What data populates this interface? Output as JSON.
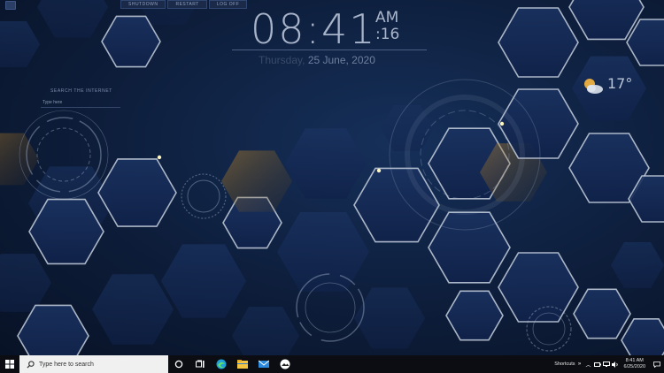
{
  "power_buttons": [
    "SHUTDOWN",
    "RESTART",
    "LOG OFF"
  ],
  "clock": {
    "time": "08:41",
    "ampm": "AM",
    "seconds": ":16",
    "day": "Thursday,",
    "date": "25 June, 2020"
  },
  "search_widget": {
    "title": "SEARCH THE INTERNET",
    "placeholder": "Type here"
  },
  "weather": {
    "temperature": "17°",
    "icon": "partly-cloudy-icon"
  },
  "taskbar": {
    "search_placeholder": "Type here to search",
    "pinned": [
      "task-view-icon",
      "edge-icon",
      "file-explorer-icon",
      "mail-icon",
      "photos-icon"
    ],
    "shortcuts_label": "Shortcuts",
    "time": "8:41 AM",
    "date": "6/25/2020"
  },
  "colors": {
    "background": "#0d1d3a",
    "hex_fill": "#15294f",
    "hex_outline": "#c7d0de",
    "accent_gold": "#d9a23b",
    "taskbar": "#0b0d12"
  }
}
